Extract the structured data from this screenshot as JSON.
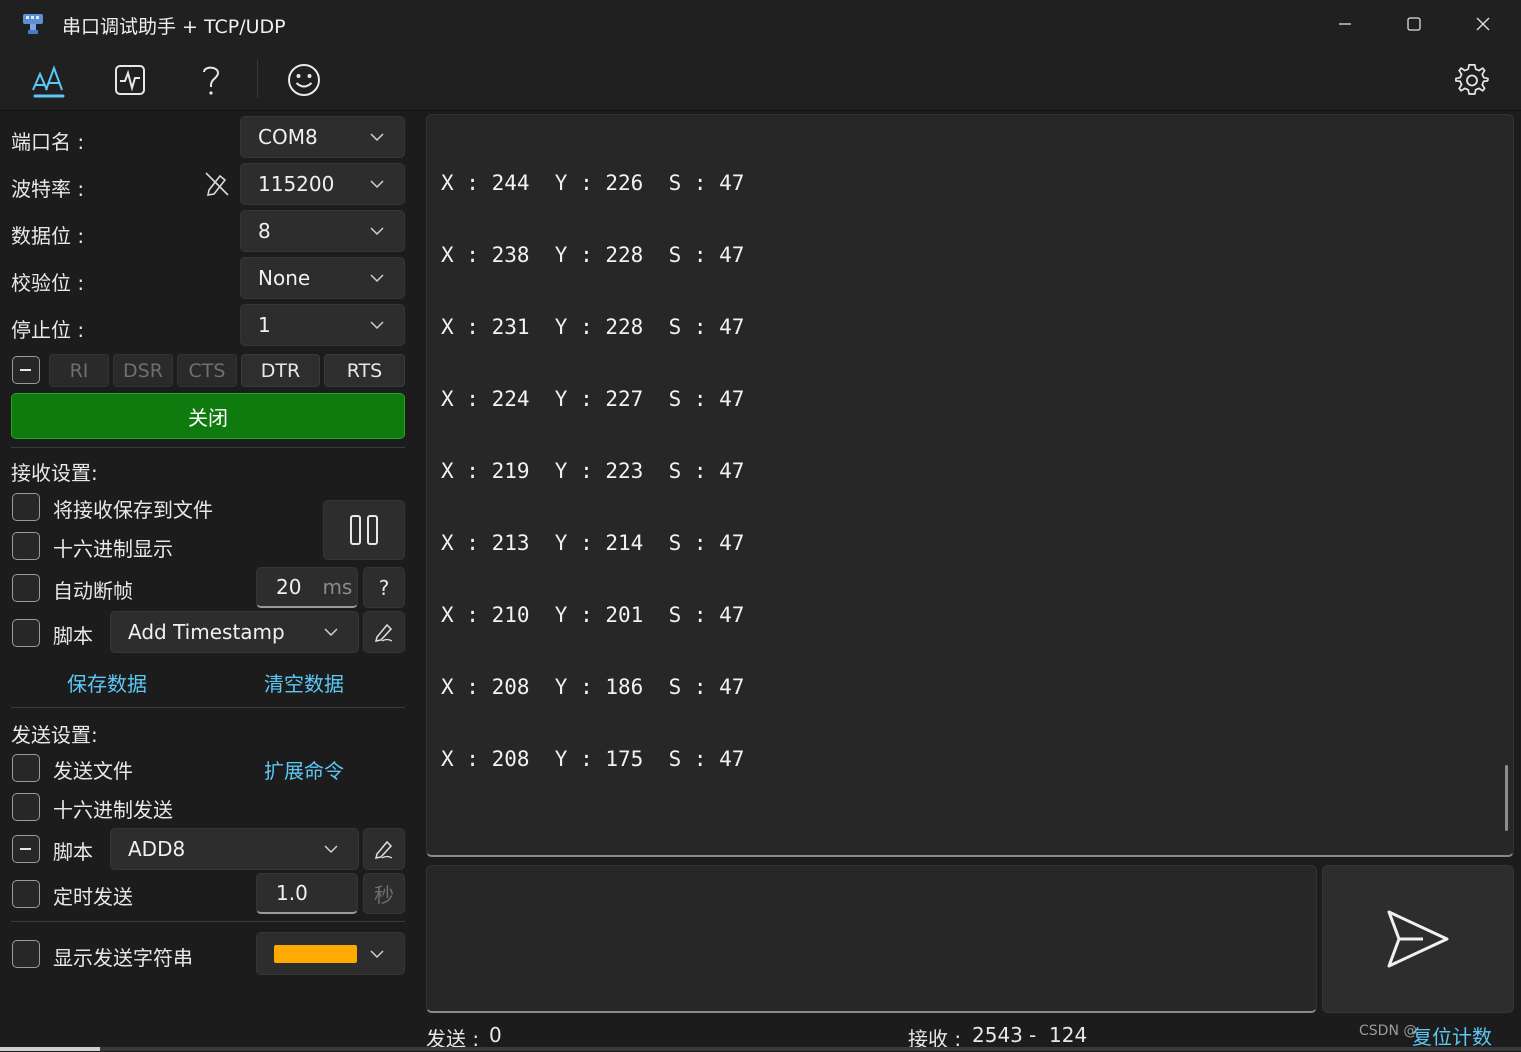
{
  "window": {
    "title": "串口调试助手 + TCP/UDP"
  },
  "serial": {
    "port_label": "端口名 :",
    "port_value": "COM8",
    "baud_label": "波特率 :",
    "baud_value": "115200",
    "databits_label": "数据位 :",
    "databits_value": "8",
    "parity_label": "校验位 :",
    "parity_value": "None",
    "stopbits_label": "停止位 :",
    "stopbits_value": "1",
    "pins": [
      "RI",
      "DSR",
      "CTS",
      "DTR",
      "RTS"
    ],
    "close_label": "关闭"
  },
  "receive": {
    "header": "接收设置:",
    "save_to_file": "将接收保存到文件",
    "hex_display": "十六进制显示",
    "auto_frame": "自动断帧",
    "auto_frame_value": "20",
    "auto_frame_unit": "ms",
    "help": "?",
    "script_label": "脚本",
    "script_value": "Add Timestamp",
    "save_data": "保存数据",
    "clear_data": "清空数据"
  },
  "send": {
    "header": "发送设置:",
    "send_file": "发送文件",
    "ext_cmd": "扩展命令",
    "hex_send": "十六进制发送",
    "script_label": "脚本",
    "script_value": "ADD8",
    "timed_send": "定时发送",
    "timed_value": "1.0",
    "timed_unit": "秒",
    "show_string": "显示发送字符串",
    "show_string_color": "#ffaa00"
  },
  "received_lines": [
    "X : 244  Y : 226  S : 47",
    "X : 238  Y : 228  S : 47",
    "X : 231  Y : 228  S : 47",
    "X : 224  Y : 227  S : 47",
    "X : 219  Y : 223  S : 47",
    "X : 213  Y : 214  S : 47",
    "X : 210  Y : 201  S : 47",
    "X : 208  Y : 186  S : 47",
    "X : 208  Y : 175  S : 47"
  ],
  "status": {
    "send_label": "发送 :",
    "send_count": "0",
    "recv_label": "接收 :",
    "recv_count": "2543",
    "recv_sep": "-",
    "recv_extra": "124",
    "reset_count": "复位计数",
    "watermark": "CSDN @"
  },
  "icons": {
    "app": "serial-port-icon",
    "font": "font-icon",
    "monitor": "waveform-icon",
    "help": "help-icon",
    "emoji": "smiley-icon",
    "settings": "gear-icon",
    "send": "send-arrow-icon"
  },
  "colors": {
    "accent": "#5cc8f5",
    "close_button": "#0f7b0f",
    "background": "#1c1c1c"
  }
}
